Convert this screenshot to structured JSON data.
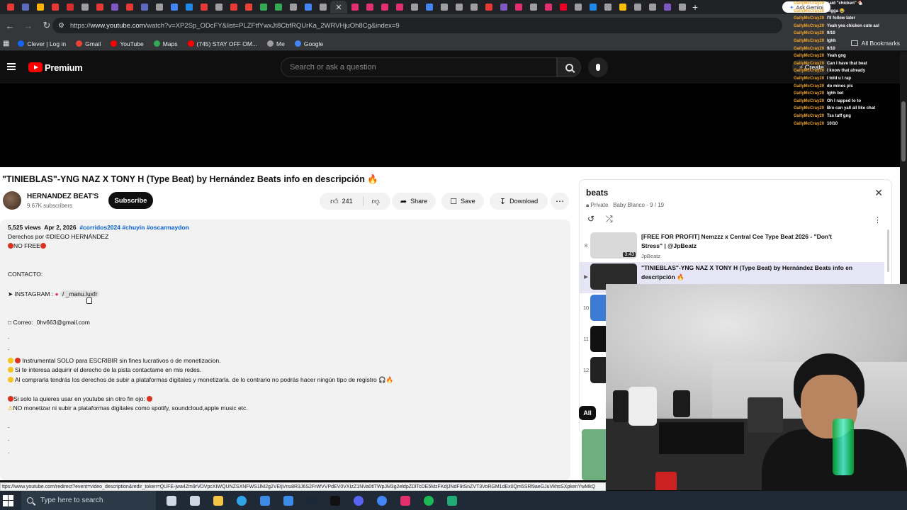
{
  "browser": {
    "tabs": [
      {
        "color": "#e53935"
      },
      {
        "color": "#5c6bc0"
      },
      {
        "color": "#ffb300"
      },
      {
        "color": "#e53935"
      },
      {
        "color": "#d32f2f"
      },
      {
        "color": "#9e9e9e"
      },
      {
        "color": "#e53935"
      },
      {
        "color": "#7e57c2"
      },
      {
        "color": "#e53935"
      },
      {
        "color": "#5c6bc0"
      },
      {
        "color": "#9e9e9e"
      },
      {
        "color": "#4285f4"
      },
      {
        "color": "#1e88e5"
      },
      {
        "color": "#e53935"
      },
      {
        "color": "#9e9e9e"
      },
      {
        "color": "#e53935"
      },
      {
        "color": "#ea4335"
      },
      {
        "color": "#34a853"
      },
      {
        "color": "#34a853"
      },
      {
        "color": "#9e9e9e"
      },
      {
        "color": "#4285f4"
      },
      {
        "color": "#9e9e9e"
      },
      {
        "color": "#ffffff",
        "active": true
      },
      {
        "color": "#e1306c"
      },
      {
        "color": "#e1306c"
      },
      {
        "color": "#e1306c"
      },
      {
        "color": "#e1306c"
      },
      {
        "color": "#9e9e9e"
      },
      {
        "color": "#4285f4"
      },
      {
        "color": "#9e9e9e"
      },
      {
        "color": "#9e9e9e"
      },
      {
        "color": "#9e9e9e"
      },
      {
        "color": "#e53935"
      },
      {
        "color": "#7e57c2"
      },
      {
        "color": "#e1306c"
      },
      {
        "color": "#9e9e9e"
      },
      {
        "color": "#e1306c"
      },
      {
        "color": "#e60023"
      },
      {
        "color": "#9e9e9e"
      },
      {
        "color": "#1e88e5"
      },
      {
        "color": "#9e9e9e"
      },
      {
        "color": "#fbbc04"
      },
      {
        "color": "#9e9e9e"
      },
      {
        "color": "#9e9e9e"
      },
      {
        "color": "#7e57c2"
      },
      {
        "color": "#9e9e9e"
      }
    ],
    "url_prefix": "https://",
    "url_domain": "www.youtube.com",
    "url_rest": "/watch?v=XP2Sp_ODcFY&list=PLZFtfYwxJt8CbfRQUrKa_2WRVHjuOh8Cg&index=9",
    "bookmarks": [
      {
        "label": "Clever | Log in",
        "color": "#1464f6"
      },
      {
        "label": "Gmail",
        "color": "#ea4335"
      },
      {
        "label": "YouTube",
        "color": "#ff0000"
      },
      {
        "label": "Maps",
        "color": "#34a853"
      },
      {
        "label": "(745) STAY OFF OM...",
        "color": "#ff0000"
      },
      {
        "label": "Me",
        "color": "#9e9e9e"
      },
      {
        "label": "Google",
        "color": "#4285f4"
      }
    ],
    "all_bookmarks": "All Bookmarks",
    "ask_gemini": "Ask Gemini"
  },
  "youtube": {
    "logo_label": "Premium",
    "search_placeholder": "Search or ask a question",
    "create_label": "+ Create",
    "video": {
      "title": "\"TINIEBLAS\"-YNG NAZ X TONY H (Type Beat) by Hernández Beats info en descripción 🔥",
      "channel": "HERNANDEZ BEAT'S",
      "subscribers": "9.67K subscribers",
      "subscribe_label": "Subscribe",
      "likes": "241",
      "share_label": "Share",
      "save_label": "Save",
      "download_label": "Download"
    },
    "description": {
      "views": "5,525 views",
      "date": "Apr 2, 2026",
      "hashtags": "#corridos2024 #chuyin #oscarmaydon",
      "rights": "Derechos por ©DIEGO HERNÁNDEZ",
      "no_free": "NO FREE",
      "contact": "CONTACTO:",
      "instagram_label": "INSTAGRAM :",
      "instagram_handle": "/ _manu.luxfr",
      "email_label": "Correo:",
      "email": "0hv663@gmail.com",
      "line1": "Instrumental SOLO para ESCRIBIR sin fines lucrativos o de monetizacion.",
      "line2": "Si te interesa adquirir el derecho de la pista contactame en mis redes.",
      "line3": "Al comprarla tendrás los derechos de subir a plataformas digitales y monetizarla. de lo contrario no podrás hacer ningún tipo de registro 🎧🔥",
      "line4": "Si solo la quieres usar  en youtube sin otro fin ojo:",
      "line5": "NO monetizar ni subir a plataformas digitales como spotify, soundcloud,apple music etc.",
      "dot1": ".",
      "dot2": ".",
      "dot3": ".",
      "dot4": ".",
      "dot5": "."
    },
    "playlist": {
      "title": "beats",
      "privacy": "Private",
      "owner": "Baby Blanco",
      "position": "9 / 19",
      "items": [
        {
          "index": "8",
          "title": "[FREE FOR PROFIT] Nemzzz x Central Cee Type Beat 2026 - \"Don't Stress\" | @JpBeatz",
          "channel": "JpBeatz",
          "duration": "3:43"
        },
        {
          "index": "▶",
          "title": "\"TINIEBLAS\"-YNG NAZ X TONY H (Type Beat) by Hernández Beats info en descripción 🔥",
          "channel": "",
          "duration": ""
        },
        {
          "index": "10",
          "title": "",
          "channel": "",
          "duration": ""
        },
        {
          "index": "11",
          "title": "",
          "channel": "",
          "duration": ""
        },
        {
          "index": "12",
          "title": "",
          "channel": "",
          "duration": ""
        }
      ]
    },
    "chip_all": "All"
  },
  "chat": [
    {
      "user": "GallyMcCray20",
      "msg": "said \"chicken\" 🐔"
    },
    {
      "user": "GallyMcCray20",
      "msg": "nigga 😂"
    },
    {
      "user": "GallyMcCray20",
      "msg": "I'll follow later"
    },
    {
      "user": "GallyMcCray20",
      "msg": "Yeah yea chicken cute asl"
    },
    {
      "user": "GallyMcCray20",
      "msg": "9/10"
    },
    {
      "user": "GallyMcCray20",
      "msg": "lghh"
    },
    {
      "user": "GallyMcCray20",
      "msg": "9/10"
    },
    {
      "user": "GallyMcCray20",
      "msg": "Yeah gng"
    },
    {
      "user": "GallyMcCray20",
      "msg": "Can I have that beat"
    },
    {
      "user": "GallyMcCray20",
      "msg": "I know that already"
    },
    {
      "user": "GallyMcCray20",
      "msg": "I told u I rap"
    },
    {
      "user": "GallyMcCray20",
      "msg": "do mines pls"
    },
    {
      "user": "GallyMcCray20",
      "msg": "lghh bet"
    },
    {
      "user": "GallyMcCray20",
      "msg": "Oh I rapped to to"
    },
    {
      "user": "GallyMcCray20",
      "msg": "Bro can yall all like chat"
    },
    {
      "user": "GallyMcCray20",
      "msg": "Tss tuff gng"
    },
    {
      "user": "GallyMcCray20",
      "msg": "10/10"
    }
  ],
  "status_url": "ttps://www.youtube.com/redirect?event=video_description&redir_token=QUFE-jwa4Zm9rVDVpcXIWQUNZSXNFWS1lM2g2VEtjVnu8R3J6S2FrWVVPdEV0VXIzZ1NVa0tlTWpJM3g2eldpZDlTcDE5MzFKdjJNdF9tSnZVT3VoRGM1dEx0Qm5SRl9aeGJuVkhsSXpkenYwMkQ",
  "taskbar": {
    "search_placeholder": "Type here to search",
    "apps": [
      {
        "name": "task-view-icon",
        "color": "#cfd8e3"
      },
      {
        "name": "widgets-icon",
        "color": "#cfd8e3"
      },
      {
        "name": "file-explorer-icon",
        "color": "#f4c542"
      },
      {
        "name": "edge-icon",
        "color": "#2fa4e7"
      },
      {
        "name": "store-icon",
        "color": "#3c8ce7"
      },
      {
        "name": "mail-icon",
        "color": "#3c8ce7"
      },
      {
        "name": "steam-icon",
        "color": "#1b2838"
      },
      {
        "name": "epic-icon",
        "color": "#111111"
      },
      {
        "name": "discord-icon",
        "color": "#5865f2"
      },
      {
        "name": "chrome-icon",
        "color": "#4285f4"
      },
      {
        "name": "instagram-icon",
        "color": "#e1306c"
      },
      {
        "name": "spotify-icon",
        "color": "#1db954"
      },
      {
        "name": "app-icon",
        "color": "#22aa77"
      }
    ]
  }
}
